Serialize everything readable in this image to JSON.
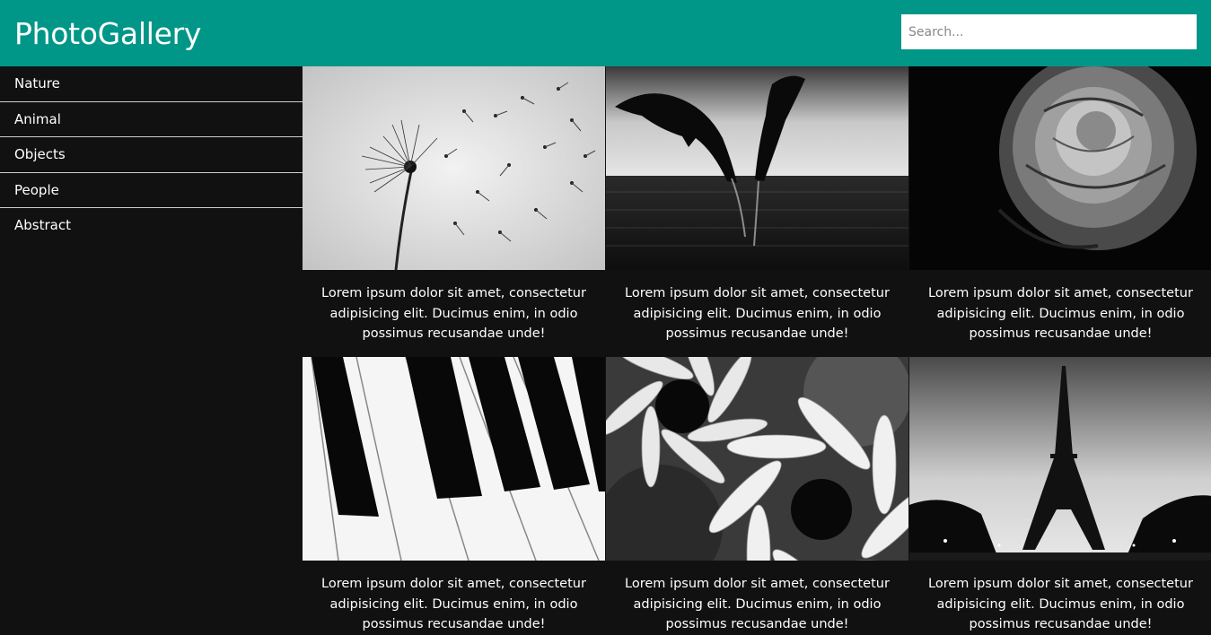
{
  "header": {
    "title": "PhotoGallery",
    "search_placeholder": "Search..."
  },
  "sidebar": {
    "items": [
      {
        "label": "Nature"
      },
      {
        "label": "Animal"
      },
      {
        "label": "Objects"
      },
      {
        "label": "People"
      },
      {
        "label": "Abstract"
      }
    ]
  },
  "gallery": {
    "photos": [
      {
        "subject": "dandelion",
        "caption": "Lorem ipsum dolor sit amet, consectetur adipisicing elit. Ducimus enim, in odio possimus recusandae unde!"
      },
      {
        "subject": "dolphins",
        "caption": "Lorem ipsum dolor sit amet, consectetur adipisicing elit. Ducimus enim, in odio possimus recusandae unde!"
      },
      {
        "subject": "rose",
        "caption": "Lorem ipsum dolor sit amet, consectetur adipisicing elit. Ducimus enim, in odio possimus recusandae unde!"
      },
      {
        "subject": "piano keys",
        "caption": "Lorem ipsum dolor sit amet, consectetur adipisicing elit. Ducimus enim, in odio possimus recusandae unde!"
      },
      {
        "subject": "daisies",
        "caption": "Lorem ipsum dolor sit amet, consectetur adipisicing elit. Ducimus enim, in odio possimus recusandae unde!"
      },
      {
        "subject": "eiffel tower",
        "caption": "Lorem ipsum dolor sit amet, consectetur adipisicing elit. Ducimus enim, in odio possimus recusandae unde!"
      }
    ]
  },
  "colors": {
    "header_bg": "#009688",
    "page_bg": "#111111",
    "text": "#ffffff"
  }
}
